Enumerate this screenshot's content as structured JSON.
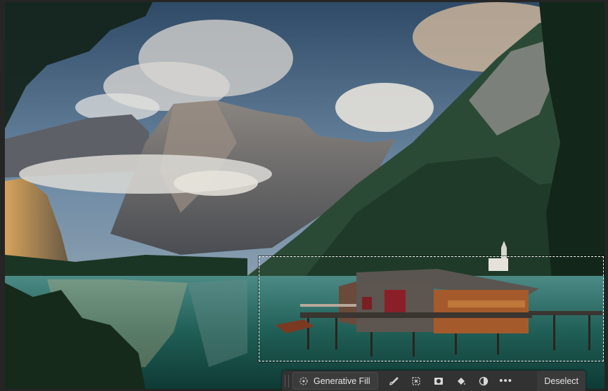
{
  "taskbar": {
    "generative_fill_label": "Generative Fill",
    "more_label": "•••",
    "deselect_label": "Deselect"
  },
  "icons": [
    "sparkle-icon",
    "brush-icon",
    "transform-icon",
    "mask-icon",
    "fill-bucket-icon",
    "adjustment-icon",
    "more-icon"
  ]
}
